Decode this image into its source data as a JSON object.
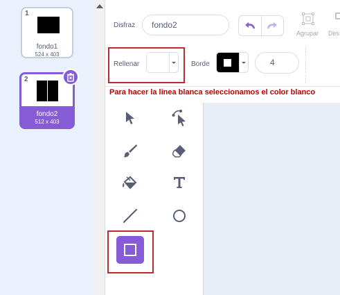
{
  "costumes": [
    {
      "number": "1",
      "name": "fondo1",
      "size": "524 x 403"
    },
    {
      "number": "2",
      "name": "fondo2",
      "size": "512 x 403"
    }
  ],
  "toolbar": {
    "costume_label": "Disfraz",
    "costume_name": "fondo2",
    "group_label": "Agrupar",
    "ungroup_label": "Des"
  },
  "fill": {
    "label": "Rellenar",
    "color": "#ffffff"
  },
  "outline": {
    "label": "Borde",
    "color": "#000000",
    "width": "4"
  },
  "annotation": "Para hacer la linea blanca seleccionamos el color blanco",
  "tools": [
    "select",
    "reshape",
    "brush",
    "eraser",
    "fill",
    "text",
    "line",
    "circle",
    "rectangle"
  ],
  "selected_tool": "rectangle",
  "colors": {
    "accent": "#855cd6",
    "highlight": "#c0282d",
    "annotation": "#c00000",
    "canvas": "#e8edf7"
  }
}
